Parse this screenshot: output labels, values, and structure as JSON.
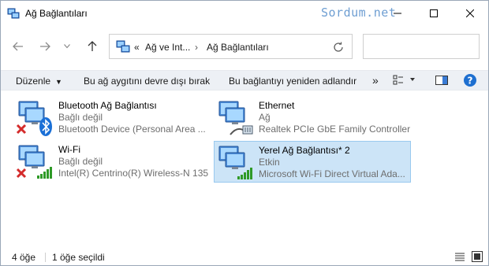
{
  "window": {
    "title": "Ağ Bağlantıları",
    "watermark": "Sordum.net"
  },
  "nav": {
    "back_icon": "back-arrow-icon",
    "forward_icon": "forward-arrow-icon",
    "history_icon": "chevron-down-icon",
    "up_icon": "up-arrow-icon"
  },
  "address": {
    "overflow": "«",
    "segments": [
      "Ağ ve Int...",
      "Ağ Bağlantıları"
    ],
    "separator": "›"
  },
  "search": {
    "placeholder": ""
  },
  "commands": {
    "organize": "Düzenle",
    "disable": "Bu ağ aygıtını devre dışı bırak",
    "rename": "Bu bağlantıyı yeniden adlandır",
    "more": "»"
  },
  "connections": [
    {
      "name": "Bluetooth Ağ Bağlantısı",
      "status": "Bağlı değil",
      "device": "Bluetooth Device (Personal Area ...",
      "selected": false
    },
    {
      "name": "Ethernet",
      "status": "Ağ",
      "device": "Realtek PCIe GbE Family Controller",
      "selected": false
    },
    {
      "name": "Wi-Fi",
      "status": "Bağlı değil",
      "device": "Intel(R) Centrino(R) Wireless-N 135",
      "selected": false
    },
    {
      "name": "Yerel Ağ Bağlantısı* 2",
      "status": "Etkin",
      "device": "Microsoft Wi-Fi Direct Virtual Ada...",
      "selected": true
    }
  ],
  "status": {
    "count": "4 öğe",
    "selected": "1 öğe seçildi"
  },
  "colors": {
    "selection_bg": "#cce4f7",
    "selection_border": "#99c9ef",
    "help": "#1e6fd0",
    "error_x": "#d42b2b",
    "signal": "#2f9a27",
    "bluetooth": "#1a6fd6"
  }
}
